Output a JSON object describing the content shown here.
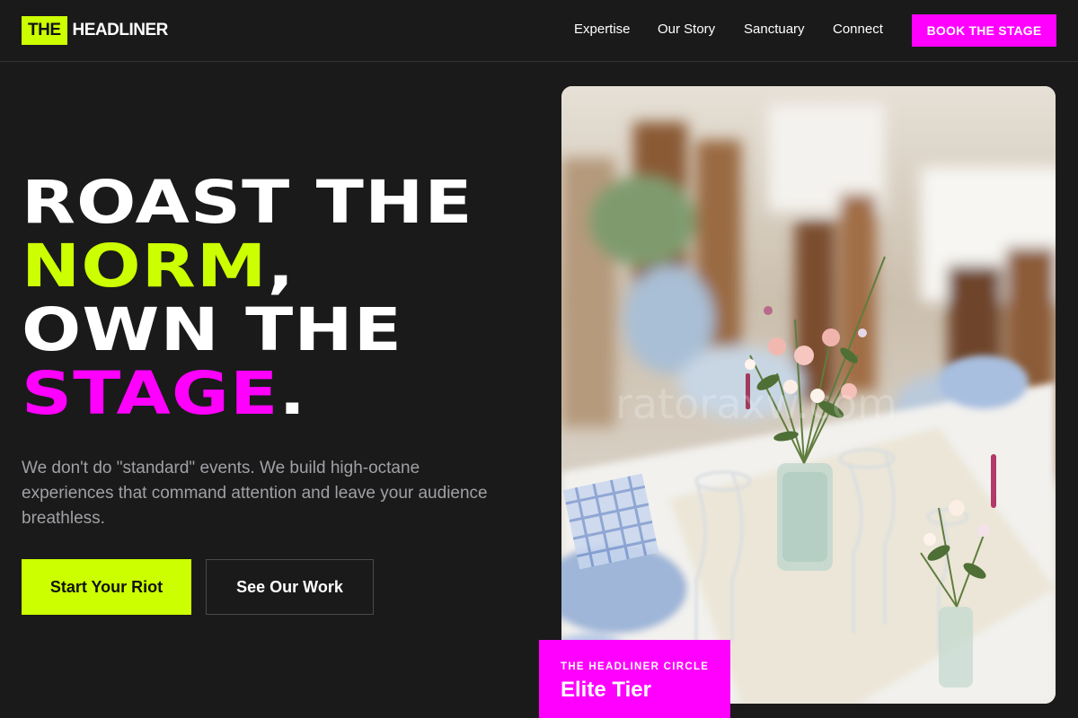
{
  "brand": {
    "logo_box": "THE",
    "logo_word": "HEADLINER"
  },
  "nav": {
    "links": [
      "Expertise",
      "Our Story",
      "Sanctuary",
      "Connect"
    ],
    "cta": "BOOK THE STAGE"
  },
  "hero": {
    "title_lines": [
      {
        "parts": [
          "ROAST THE"
        ]
      },
      {
        "parts": [
          "NORM",
          ","
        ]
      },
      {
        "parts": [
          "OWN THE"
        ]
      },
      {
        "parts": [
          "STAGE",
          "."
        ]
      }
    ],
    "copy": "We don't do \"standard\" events. We build high-octane experiences that command attention and leave your audience breathless.",
    "primary_cta": "Start Your Riot",
    "secondary_cta": "See Our Work"
  },
  "image": {
    "subject": "wedding table with flowers and glassware",
    "watermark": "ratoraxw.com"
  },
  "badge": {
    "kicker": "THE HEADLINER CIRCLE",
    "title": "Elite Tier"
  },
  "colors": {
    "background": "#1a1a1a",
    "lime": "#ccff00",
    "magenta": "#ff00ff",
    "muted": "#a0a0a6"
  }
}
